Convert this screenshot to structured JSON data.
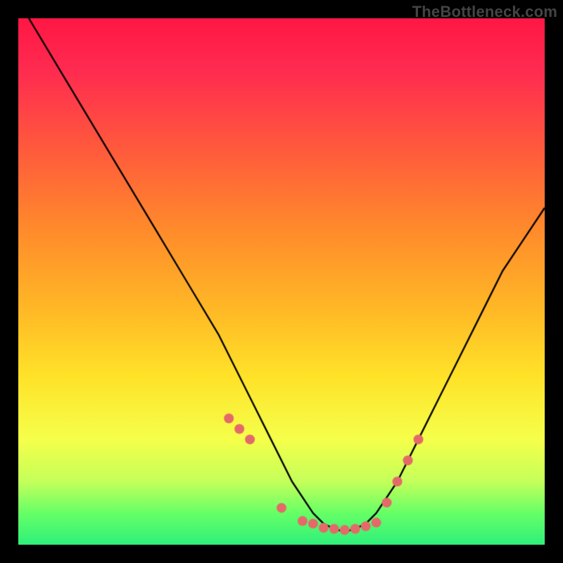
{
  "watermark": "TheBottleneck.com",
  "chart_data": {
    "type": "line",
    "title": "",
    "xlabel": "",
    "ylabel": "",
    "xlim": [
      0,
      100
    ],
    "ylim": [
      0,
      100
    ],
    "curve": {
      "name": "bottleneck-v-curve",
      "x": [
        2,
        8,
        14,
        20,
        26,
        32,
        38,
        44,
        48,
        52,
        56,
        58,
        60,
        62,
        64,
        66,
        68,
        72,
        76,
        80,
        84,
        88,
        92,
        96,
        100
      ],
      "y": [
        100,
        90,
        80,
        70,
        60,
        50,
        40,
        28,
        20,
        12,
        6,
        4,
        3,
        2.5,
        3,
        4,
        6,
        12,
        20,
        28,
        36,
        44,
        52,
        58,
        64
      ]
    },
    "dots": {
      "name": "recommended-range",
      "color": "#e46a6a",
      "radius": 7,
      "x": [
        40,
        42,
        44,
        50,
        54,
        56,
        58,
        60,
        62,
        64,
        66,
        68,
        70,
        72,
        74,
        76
      ],
      "y": [
        24,
        22,
        20,
        7,
        4.5,
        4,
        3.2,
        3,
        2.8,
        3,
        3.5,
        4.2,
        8,
        12,
        16,
        20
      ]
    },
    "gradient_stops": [
      {
        "pos": 0.0,
        "color": "#ff1744"
      },
      {
        "pos": 0.25,
        "color": "#ff5a3c"
      },
      {
        "pos": 0.55,
        "color": "#ffb726"
      },
      {
        "pos": 0.8,
        "color": "#f5ff4a"
      },
      {
        "pos": 1.0,
        "color": "#2ef07a"
      }
    ],
    "annotations": []
  }
}
